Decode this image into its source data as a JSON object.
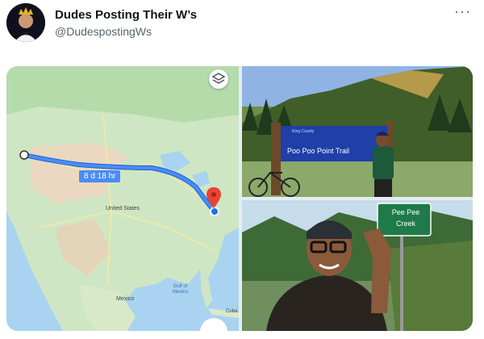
{
  "tweet": {
    "display_name": "Dudes Posting Their W’s",
    "handle": "@DudespostingWs",
    "more_icon": "more-icon"
  },
  "map": {
    "duration_label": "8 d 18 hr",
    "country_label": "United States",
    "mexico_label": "Mexico",
    "gulf_label_1": "Gulf of",
    "gulf_label_2": "Mexico",
    "cuba_label": "Cuba",
    "layers_icon": "layers-icon",
    "pin_icon": "map-pin-icon",
    "route_color": "#4a8cf7"
  },
  "trail_photo": {
    "sign_header": "King County",
    "sign_text": "Poo Poo Point Trail"
  },
  "creek_photo": {
    "sign_line1": "Pee Pee",
    "sign_line2": "Creek"
  }
}
